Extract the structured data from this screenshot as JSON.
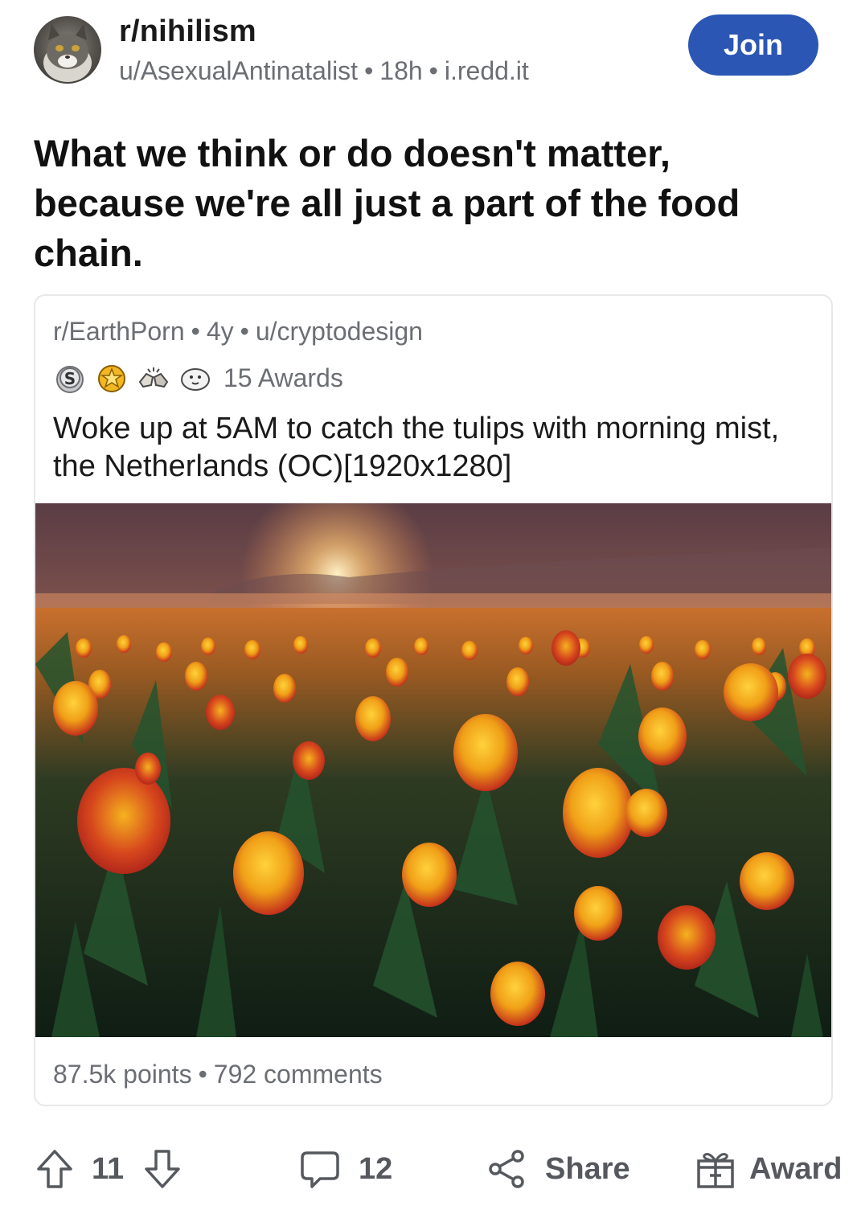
{
  "header": {
    "subreddit": "r/nihilism",
    "author": "u/AsexualAntinatalist",
    "age": "18h",
    "domain": "i.redd.it",
    "separator": "•",
    "join_label": "Join"
  },
  "post": {
    "title": "What we think or do doesn't matter, because we're all just a part of the food chain."
  },
  "crosspost": {
    "subreddit": "r/EarthPorn",
    "age": "4y",
    "author": "u/cryptodesign",
    "separator": "•",
    "awards_label": "15 Awards",
    "award_icons": [
      "silver-award-icon",
      "gold-award-icon",
      "fist-bump-award-icon",
      "seal-award-icon"
    ],
    "title": "Woke up at 5AM to catch the tulips with morning mist, the Netherlands (OC)[1920x1280]",
    "points": "87.5k points",
    "comments": "792 comments"
  },
  "actions": {
    "upvote_count": "11",
    "comment_count": "12",
    "share_label": "Share",
    "award_label": "Award"
  },
  "colors": {
    "join_button": "#2b56b3",
    "meta_text": "#6b6e73",
    "action_text": "#55585d"
  }
}
